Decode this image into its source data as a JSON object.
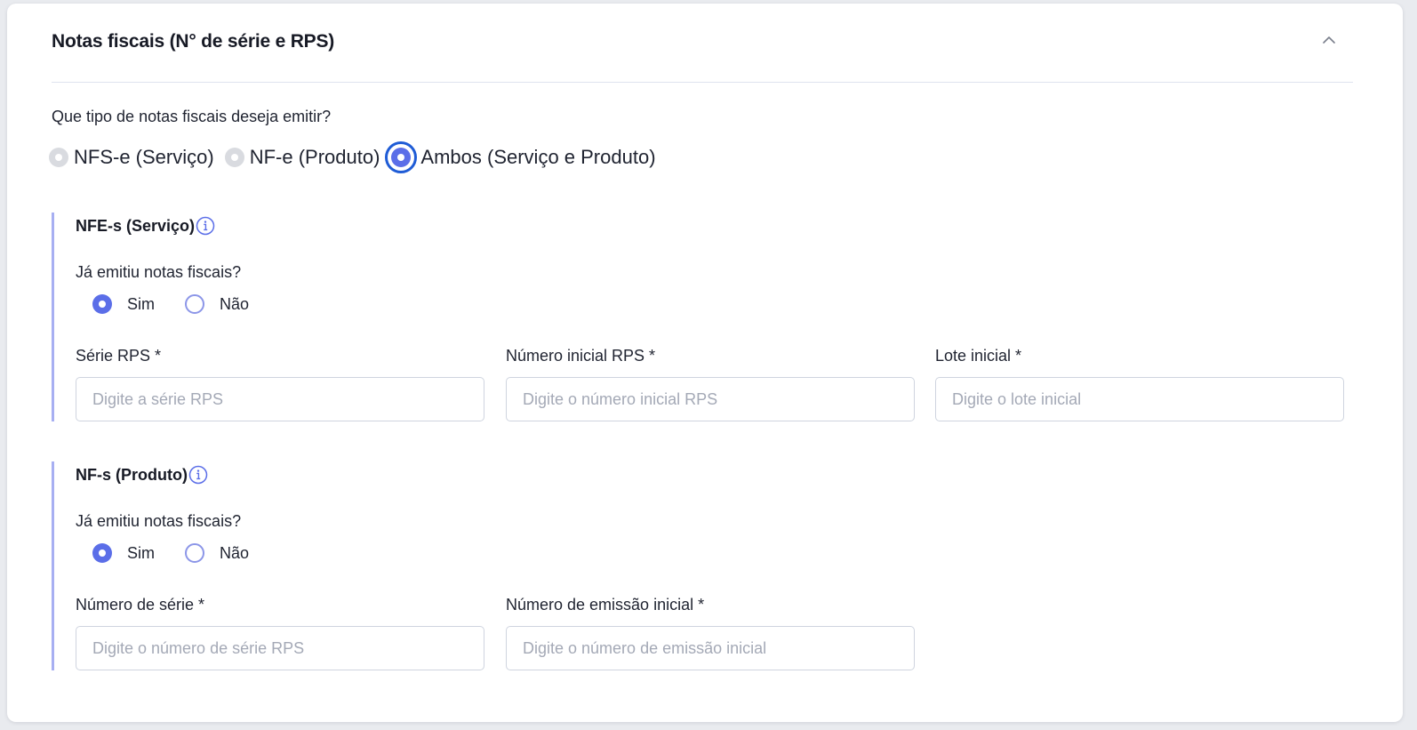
{
  "card": {
    "title": "Notas fiscais (N° de série e RPS)"
  },
  "question": "Que tipo de notas fiscais deseja emitir?",
  "type_options": [
    {
      "label": "NFS-e (Serviço)",
      "state": "disabled"
    },
    {
      "label": "NF-e (Produto)",
      "state": "disabled"
    },
    {
      "label": "Ambos (Serviço e Produto)",
      "state": "selected"
    }
  ],
  "servico": {
    "title": "NFE-s (Serviço)",
    "question": "Já emitiu notas fiscais?",
    "yes_label": "Sim",
    "no_label": "Não",
    "selected": "Sim",
    "fields": {
      "serie": {
        "label": "Série RPS *",
        "placeholder": "Digite a série RPS",
        "value": ""
      },
      "numero": {
        "label": "Número inicial RPS *",
        "placeholder": "Digite o número inicial RPS",
        "value": ""
      },
      "lote": {
        "label": "Lote inicial *",
        "placeholder": "Digite o lote inicial",
        "value": ""
      }
    }
  },
  "produto": {
    "title": "NF-s (Produto)",
    "question": "Já emitiu notas fiscais?",
    "yes_label": "Sim",
    "no_label": "Não",
    "selected": "Sim",
    "fields": {
      "serie": {
        "label": "Número de série *",
        "placeholder": "Digite o número de série RPS",
        "value": ""
      },
      "emissao": {
        "label": "Número de emissão inicial *",
        "placeholder": "Digite o número de emissão inicial",
        "value": ""
      }
    }
  },
  "colors": {
    "accent": "#5b6ee8",
    "focus_ring": "#1f5cd6",
    "section_rule": "#a7aff2",
    "disabled_radio": "#d9dbe0",
    "placeholder": "#a4a9b6"
  }
}
